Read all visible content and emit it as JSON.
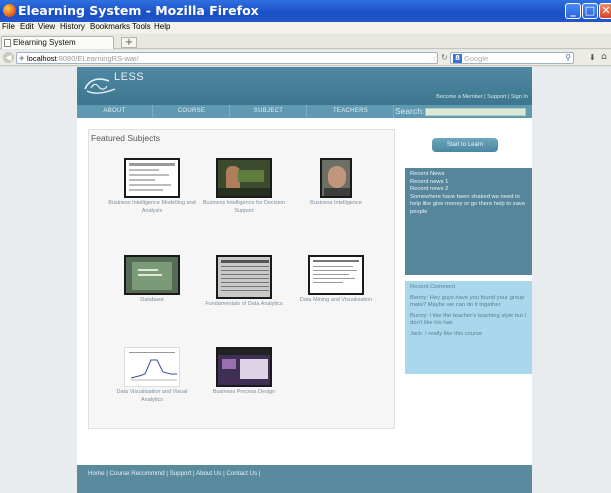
{
  "window": {
    "title": "Elearning System - Mozilla Firefox"
  },
  "menu": [
    "File",
    "Edit",
    "View",
    "History",
    "Bookmarks",
    "Tools",
    "Help"
  ],
  "tab": {
    "label": "Elearning System",
    "new_tab": "+"
  },
  "address": {
    "host": "localhost",
    "path": ":8080/ELearningRS-war/"
  },
  "search": {
    "engine": "Google",
    "placeholder": "Google"
  },
  "site": {
    "logo": "LESS",
    "header_links": "Become a Member | Support | Sign In",
    "nav": [
      "ABOUT",
      "COURSE",
      "SUBJECT",
      "TEACHERS"
    ],
    "search_label": "Search:"
  },
  "featured": {
    "title": "Featured Subjects",
    "subjects": [
      {
        "caption": "Business Intelligence Modelling and Analysis"
      },
      {
        "caption": "Business Intelligence for Decision Support"
      },
      {
        "caption": "Business Intelligence"
      },
      {
        "caption": "Database"
      },
      {
        "caption": "Fundamentals of Data Analytics"
      },
      {
        "caption": "Data Mining and Visualisation"
      },
      {
        "caption": "Data Visualisation and Visual Analytics"
      },
      {
        "caption": "Business Process Design"
      }
    ]
  },
  "sidebar": {
    "start_button": "Start to Learn",
    "news_title": "Recent News",
    "news": [
      "Recent news 1",
      "Recent news 2",
      "Somewhere have been shaked we need to help like give money or go there help to save people"
    ],
    "comments_title": "Recent Comment",
    "comments": [
      "Benny: Hey guys have you found your group mate? Maybe we can do it together",
      "Bunny: I like the teacher's teaching style but I don't like his hair",
      "Jack: I really like this course"
    ]
  },
  "footer": {
    "links": "Home | Course Recommmd | Support | About Us | Contact Us |"
  }
}
